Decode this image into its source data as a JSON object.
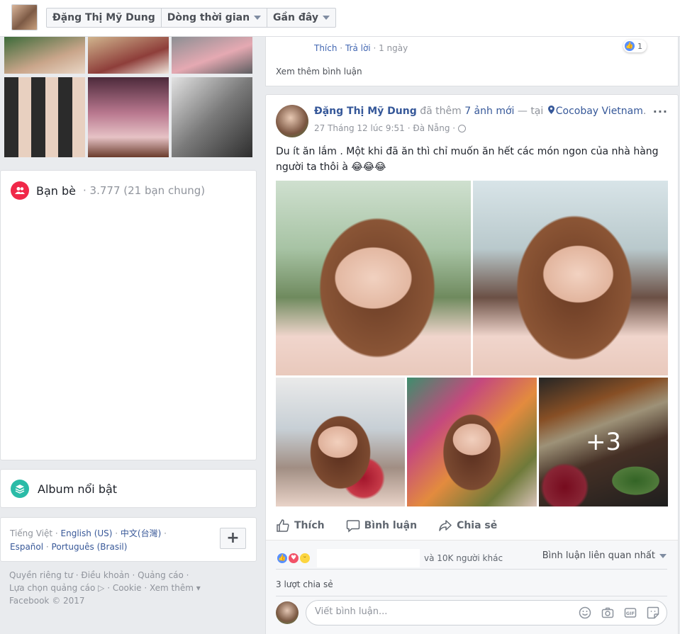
{
  "header": {
    "profile_name": "Đặng Thị Mỹ Dung",
    "nav_timeline": "Dòng thời gian",
    "nav_recent": "Gần đây"
  },
  "prev_comment": {
    "like_label": "Thích",
    "reply_label": "Trả lời",
    "time": "1 ngày",
    "like_count": "1",
    "see_more_comments": "Xem thêm bình luận"
  },
  "sidebar": {
    "friends_title": "Bạn bè",
    "friends_count": "· 3.777 (21 bạn chung)",
    "album_title": "Album nổi bật",
    "languages": [
      "Tiếng Việt",
      "English (US)",
      "中文(台灣)",
      "Español",
      "Português (Brasil)"
    ],
    "add_language": "+",
    "footer_line1": "Quyền riêng tư · Điều khoản · Quảng cáo ·",
    "footer_line2": "Lựa chọn quảng cáo ▷ · Cookie · Xem thêm ▾",
    "footer_line3": "Facebook © 2017"
  },
  "post": {
    "author": "Đặng Thị Mỹ Dung",
    "action_text": " đã thêm ",
    "photo_count_link": "7 ảnh mới",
    "at_text": " — tại ",
    "location": "Cocobay Vietnam",
    "date": "27 Tháng 12 lúc 9:51",
    "place": "· Đà Nẵng ·",
    "more": "···",
    "text": "Du ít ăn lắm . Một khi đã ăn thì chỉ muốn ăn hết các món ngon của nhà hàng người ta thôi à 😂😂😂",
    "extra_photos": "+3",
    "actions": {
      "like": "Thích",
      "comment": "Bình luận",
      "share": "Chia sẻ"
    },
    "reactions_text": "và 10K người khác",
    "sort_label": "Bình luận liên quan nhất",
    "shares_text": "3 lượt chia sẻ",
    "comment_placeholder": "Viết bình luận..."
  },
  "colors": {
    "brand_blue": "#4267b2",
    "link_blue": "#365899",
    "friends_icon": "#f02849",
    "album_icon": "#2abba7",
    "like_blue": "#5890ff",
    "love_red": "#f25268",
    "haha_yellow": "#fcd53f"
  }
}
